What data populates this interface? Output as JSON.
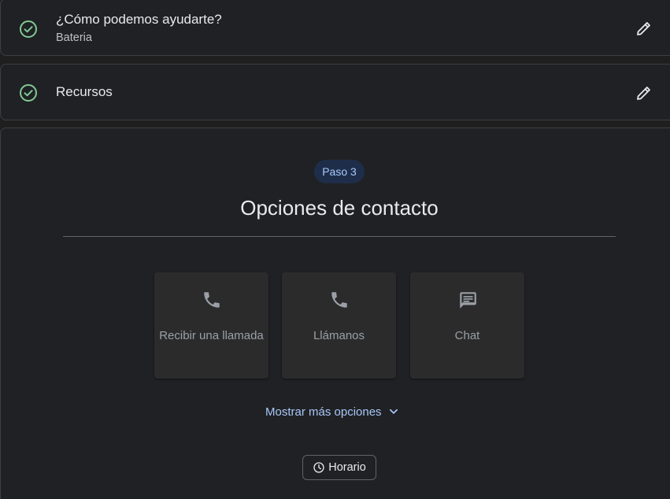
{
  "colors": {
    "success": "#81c995",
    "accent": "#a8c7fa",
    "chip_bg": "#1e2e4a",
    "card_bg": "#202124",
    "tile_bg": "#2b2b2c"
  },
  "steps": [
    {
      "title": "¿Cómo podemos ayudarte?",
      "subtitle": "Bateria",
      "status_icon": "check-circle-icon",
      "action_icon": "edit-pencil-icon"
    },
    {
      "title": "Recursos",
      "status_icon": "check-circle-icon",
      "action_icon": "edit-pencil-icon"
    }
  ],
  "current_step": {
    "badge": "Paso 3",
    "title": "Opciones de contacto",
    "options": [
      {
        "label": "Recibir una llamada",
        "icon": "phone-icon"
      },
      {
        "label": "Llámanos",
        "icon": "phone-icon"
      },
      {
        "label": "Chat",
        "icon": "chat-icon"
      }
    ],
    "more_options_label": "Mostrar más opciones",
    "hours_label": "Horario"
  }
}
